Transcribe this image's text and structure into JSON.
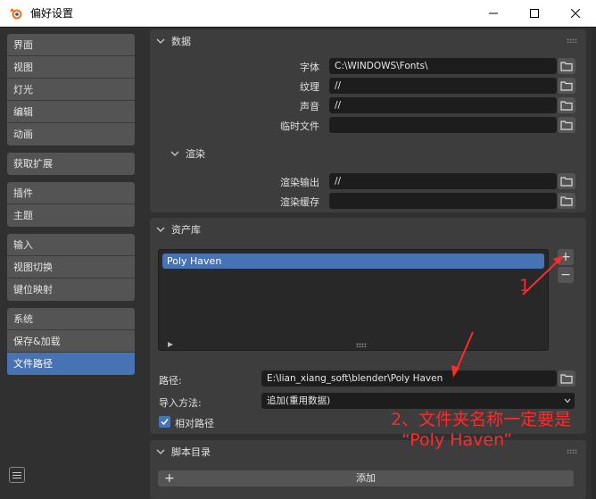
{
  "window": {
    "title": "偏好设置",
    "minimize_icon": "minimize-icon",
    "maximize_icon": "maximize-icon",
    "close_icon": "close-icon"
  },
  "sidebar": {
    "groups": [
      [
        "界面",
        "视图",
        "灯光",
        "编辑",
        "动画"
      ],
      [
        "获取扩展"
      ],
      [
        "插件",
        "主题"
      ],
      [
        "输入",
        "视图切换",
        "键位映射"
      ],
      [
        "系统",
        "保存&加载",
        "文件路径"
      ]
    ],
    "active": "文件路径"
  },
  "data_panel": {
    "title": "数据",
    "font_label": "字体",
    "font_value": "C:\\WINDOWS\\Fonts\\",
    "texture_label": "纹理",
    "texture_value": "//",
    "sound_label": "声音",
    "sound_value": "//",
    "temp_label": "临时文件",
    "temp_value": "",
    "render_title": "渲染",
    "render_output_label": "渲染输出",
    "render_output_value": "//",
    "render_cache_label": "渲染缓存",
    "render_cache_value": ""
  },
  "asset_panel": {
    "title": "资产库",
    "libraries": [
      "Poly Haven"
    ],
    "add_icon": "+",
    "remove_icon": "−",
    "path_label": "路径:",
    "path_value": "E:\\lian_xiang_soft\\blender\\Poly Haven",
    "import_label": "导入方法:",
    "import_value": "追加(重用数据)",
    "relative_label": "相对路径",
    "relative_checked": true
  },
  "script_panel": {
    "title": "脚本目录",
    "add_label": "添加"
  },
  "annotations": {
    "a1": "1",
    "a2_line1": "2、文件夹名称一定要是",
    "a2_line2": "“Poly Haven”",
    "color": "#ff2a2a"
  }
}
